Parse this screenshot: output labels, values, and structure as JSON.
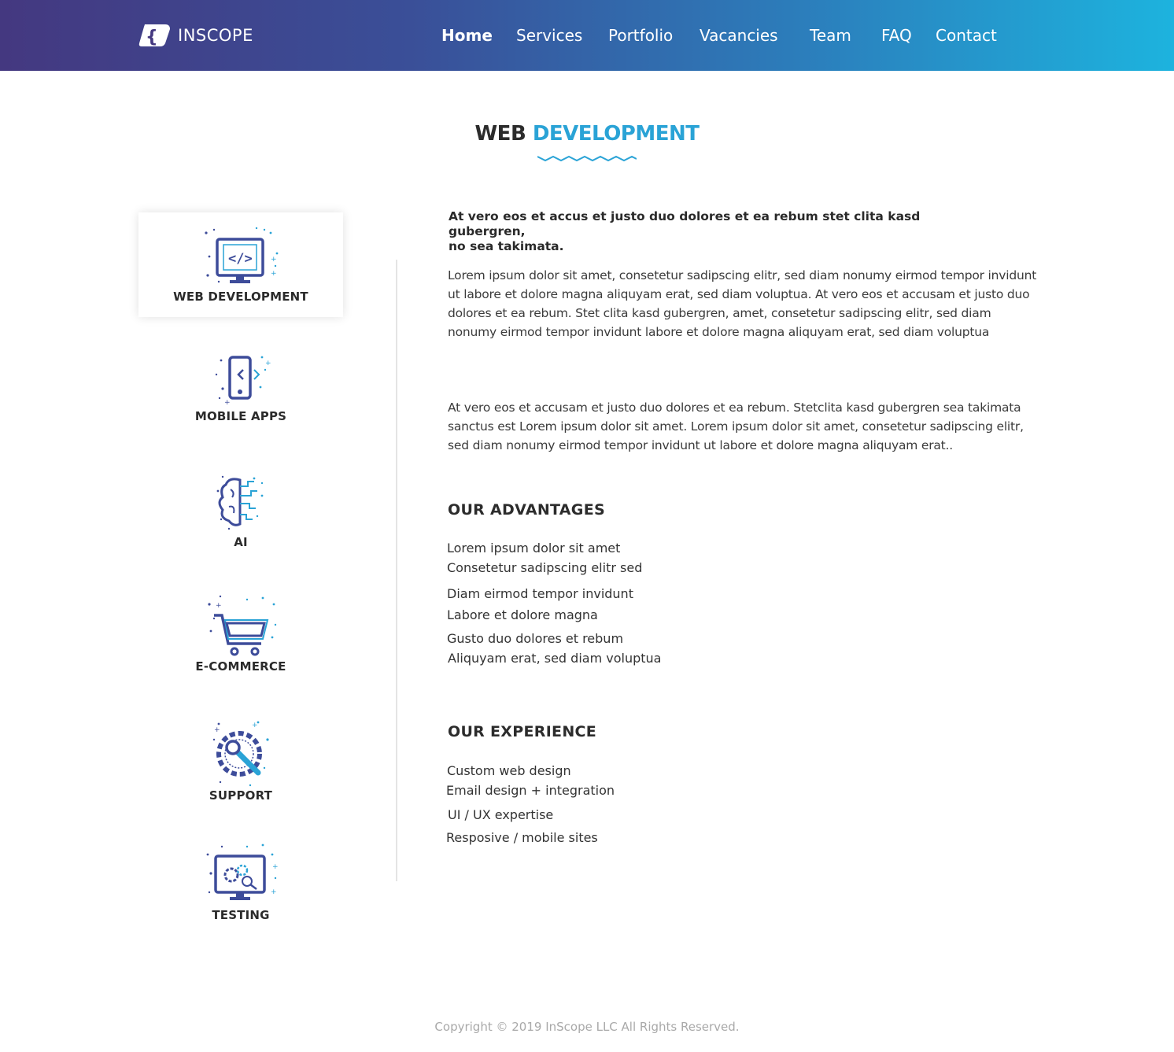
{
  "brand": {
    "name": "INSCOPE",
    "gradient": [
      "#443880",
      "#1db3de"
    ],
    "accent": "#2aa3d6"
  },
  "nav": {
    "items": [
      "Home",
      "Services",
      "Portfolio",
      "Vacancies",
      "Team",
      "FAQ",
      "Contact"
    ],
    "active": "Home"
  },
  "title": {
    "part1": "WEB",
    "part2": "DEVELOPMENT"
  },
  "sidebar": {
    "items": [
      {
        "label": "WEB DEVELOPMENT",
        "icon": "monitor-code-icon"
      },
      {
        "label": "MOBILE APPS",
        "icon": "smartphone-icon"
      },
      {
        "label": "AI",
        "icon": "brain-circuit-icon"
      },
      {
        "label": "E-COMMERCE",
        "icon": "shopping-cart-icon"
      },
      {
        "label": "SUPPORT",
        "icon": "gear-wrench-icon"
      },
      {
        "label": "TESTING",
        "icon": "monitor-gears-icon"
      }
    ],
    "active": "WEB DEVELOPMENT"
  },
  "content": {
    "lead_line1": "At vero eos et accus et justo duo dolores et ea rebum stet clita kasd gubergren,",
    "lead_line2": "no sea takimata.",
    "para1": "Lorem ipsum dolor sit amet, consetetur sadipscing elitr, sed diam nonumy eirmod tempor invidunt ut labore et dolore magna aliquyam erat, sed diam voluptua. At vero eos et accusam et justo duo dolores et ea rebum. Stet clita kasd gubergren, amet, consetetur sadipscing elitr, sed diam nonumy eirmod tempor invidunt labore et dolore magna aliquyam erat, sed diam voluptua",
    "para2": "At vero eos et accusam et justo duo dolores et ea rebum. Stetclita kasd gubergren sea takimata sanctus est Lorem ipsum dolor sit amet. Lorem ipsum dolor sit amet, consetetur sadipscing elitr, sed diam nonumy eirmod tempor invidunt ut labore et dolore magna aliquyam erat..",
    "advantages_heading": "OUR ADVANTAGES",
    "advantages": [
      "Lorem ipsum dolor sit amet",
      "Consetetur sadipscing elitr sed",
      "Diam eirmod tempor invidunt",
      "Labore et dolore magna",
      "Gusto duo dolores et rebum",
      "Aliquyam erat, sed diam voluptua"
    ],
    "experience_heading": "OUR EXPERIENCE",
    "experience": [
      "Custom web design",
      "Email design + integration",
      "UI / UX expertise",
      "Resposive / mobile sites"
    ]
  },
  "footer": {
    "copyright": "Copyright © 2019 InScope LLC All Rights Reserved."
  }
}
